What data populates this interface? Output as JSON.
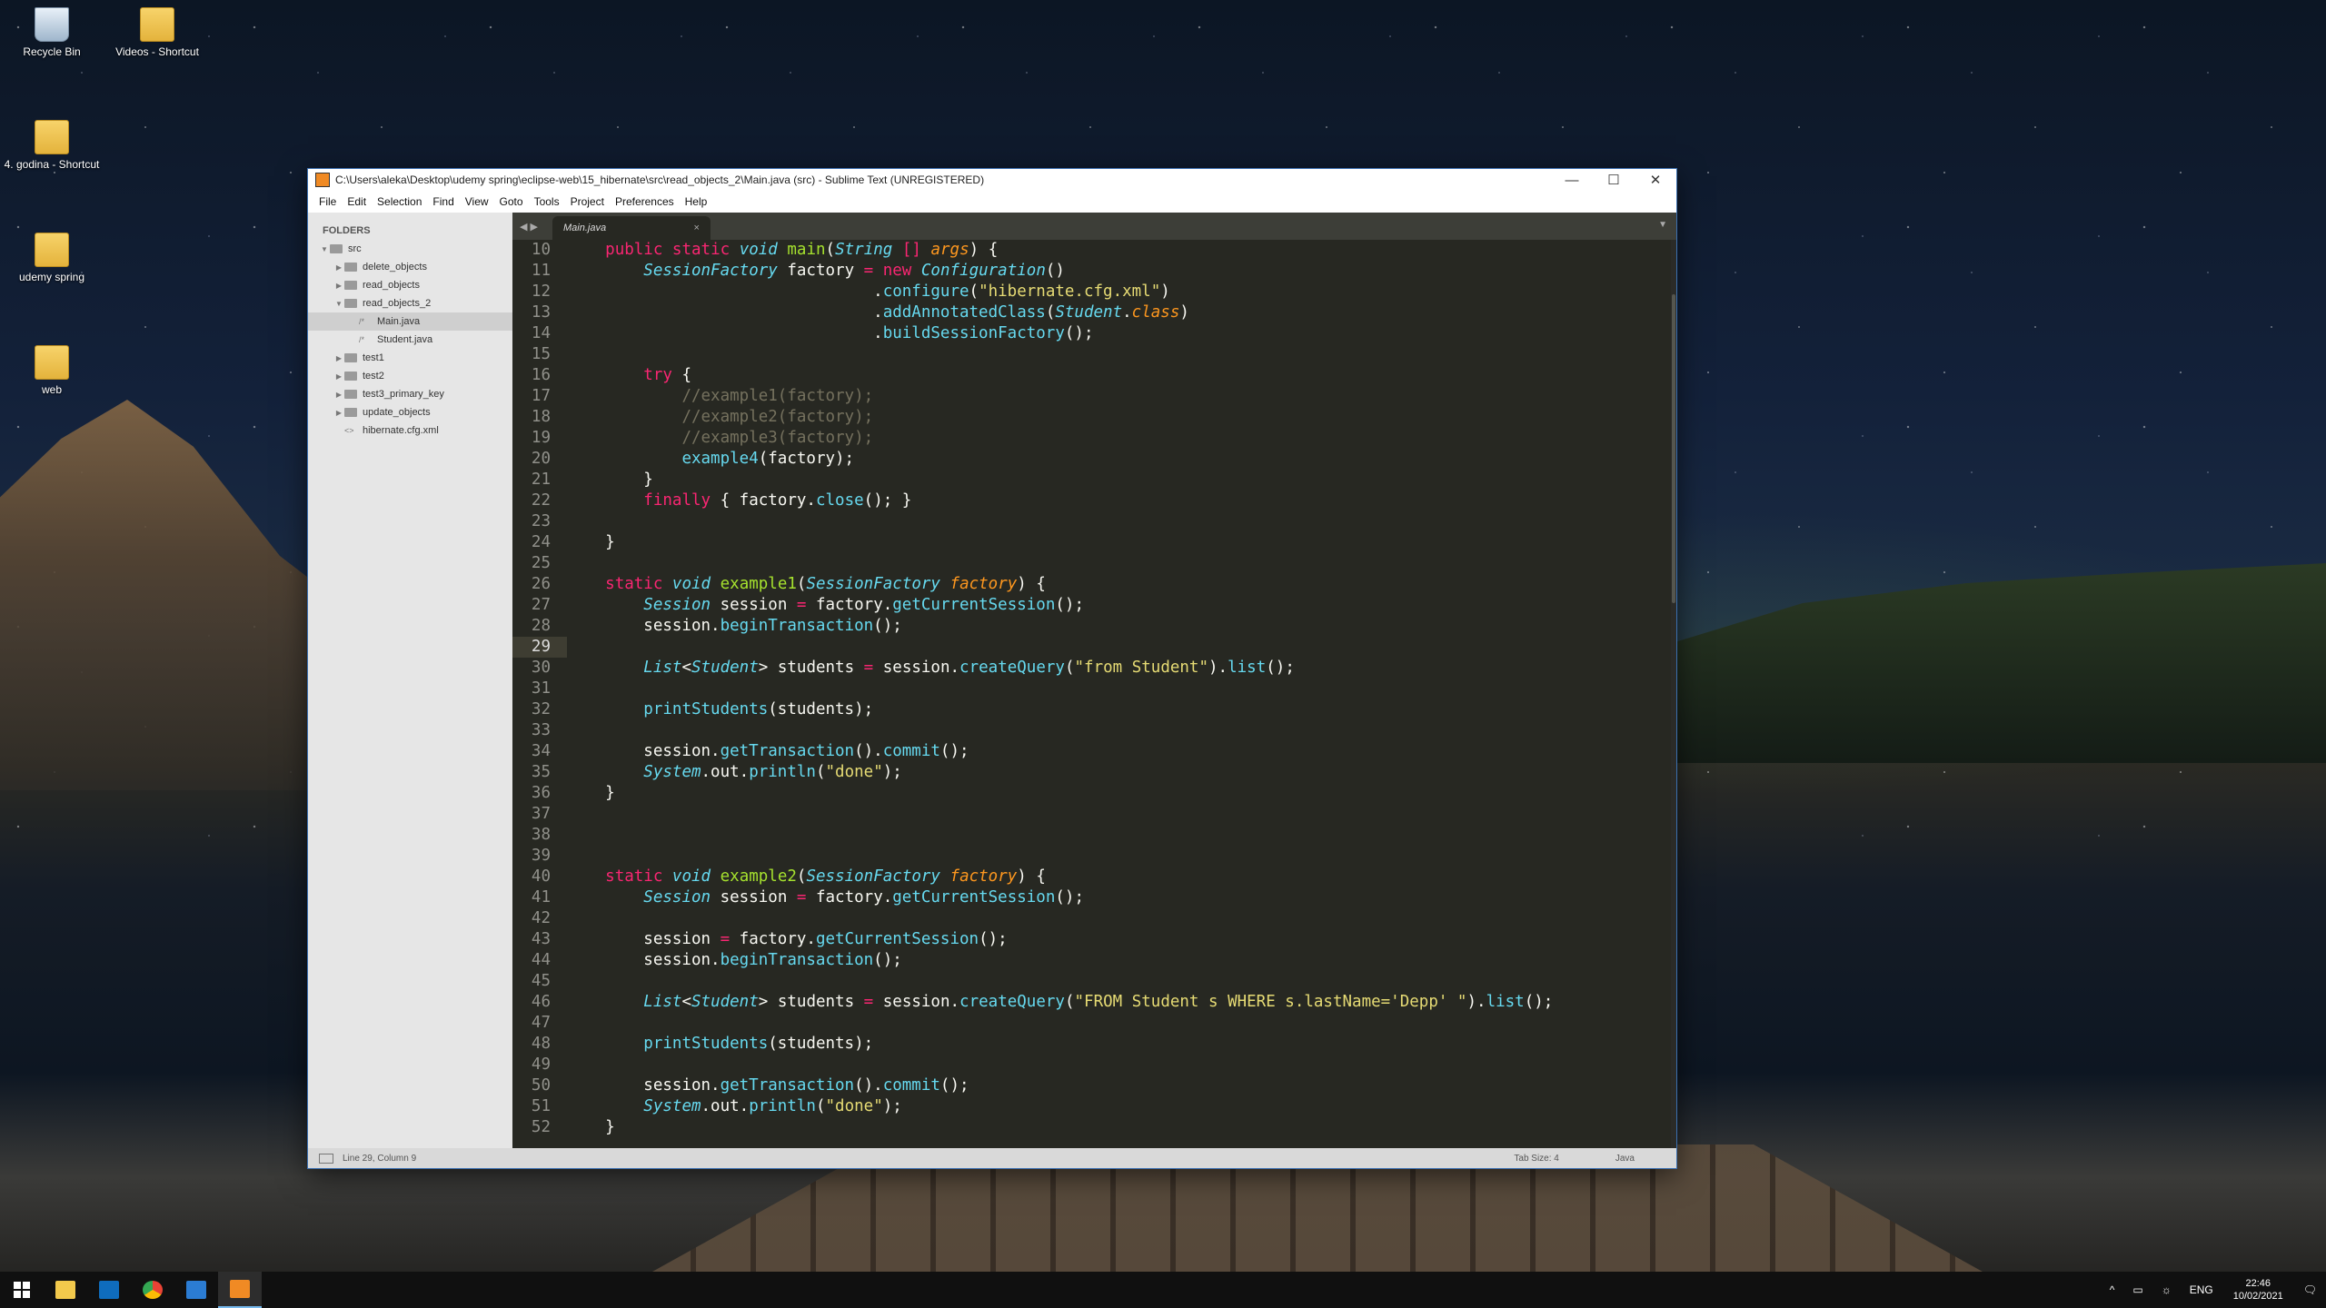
{
  "desktop": {
    "icons": [
      {
        "label": "Recycle Bin",
        "icon": "recycle-bin-icon"
      },
      {
        "label": "Videos - Shortcut",
        "icon": "folder-shortcut-icon"
      },
      {
        "label": "4. godina - Shortcut",
        "icon": "folder-shortcut-icon"
      },
      {
        "label": "udemy spring",
        "icon": "folder-icon"
      },
      {
        "label": "web",
        "icon": "folder-icon"
      }
    ]
  },
  "window": {
    "title": "C:\\Users\\aleka\\Desktop\\udemy spring\\eclipse-web\\15_hibernate\\src\\read_objects_2\\Main.java (src) - Sublime Text (UNREGISTERED)",
    "controls": {
      "minimize": "—",
      "maximize": "☐",
      "close": "✕"
    }
  },
  "menu": [
    "File",
    "Edit",
    "Selection",
    "Find",
    "View",
    "Goto",
    "Tools",
    "Project",
    "Preferences",
    "Help"
  ],
  "sidebar": {
    "header": "FOLDERS",
    "tree": [
      {
        "label": "src",
        "depth": 0,
        "type": "folder",
        "expanded": true
      },
      {
        "label": "delete_objects",
        "depth": 1,
        "type": "folder",
        "expanded": false
      },
      {
        "label": "read_objects",
        "depth": 1,
        "type": "folder",
        "expanded": false
      },
      {
        "label": "read_objects_2",
        "depth": 1,
        "type": "folder",
        "expanded": true
      },
      {
        "label": "Main.java",
        "depth": 2,
        "type": "file",
        "selected": true
      },
      {
        "label": "Student.java",
        "depth": 2,
        "type": "file"
      },
      {
        "label": "test1",
        "depth": 1,
        "type": "folder",
        "expanded": false
      },
      {
        "label": "test2",
        "depth": 1,
        "type": "folder",
        "expanded": false
      },
      {
        "label": "test3_primary_key",
        "depth": 1,
        "type": "folder",
        "expanded": false
      },
      {
        "label": "update_objects",
        "depth": 1,
        "type": "folder",
        "expanded": false
      },
      {
        "label": "hibernate.cfg.xml",
        "depth": 1,
        "type": "xml"
      }
    ]
  },
  "tabs": [
    {
      "label": "Main.java",
      "active": true,
      "close": "×"
    }
  ],
  "tab_nav": "◀ ▶",
  "tab_dropdown": "▼",
  "editor": {
    "current_line": 29,
    "lines": [
      {
        "n": 10,
        "t": [
          [
            "    ",
            ""
          ],
          [
            "public",
            "k"
          ],
          [
            " ",
            ""
          ],
          [
            "static",
            "k"
          ],
          [
            " ",
            ""
          ],
          [
            "void",
            "t"
          ],
          [
            " ",
            ""
          ],
          [
            "main",
            "f"
          ],
          [
            "(",
            ""
          ],
          [
            "String",
            "t"
          ],
          [
            " ",
            ""
          ],
          [
            "[]",
            "k"
          ],
          [
            " ",
            ""
          ],
          [
            "args",
            "p"
          ],
          [
            ") {",
            ""
          ]
        ]
      },
      {
        "n": 11,
        "t": [
          [
            "        ",
            ""
          ],
          [
            "SessionFactory",
            "t"
          ],
          [
            " factory ",
            ""
          ],
          [
            "=",
            "k"
          ],
          [
            " ",
            ""
          ],
          [
            "new",
            "k"
          ],
          [
            " ",
            ""
          ],
          [
            "Configuration",
            "t"
          ],
          [
            "()",
            ""
          ]
        ]
      },
      {
        "n": 12,
        "t": [
          [
            "                                .",
            ""
          ],
          [
            "configure",
            "c"
          ],
          [
            "(",
            ""
          ],
          [
            "\"hibernate.cfg.xml\"",
            "s"
          ],
          [
            ")",
            ""
          ]
        ]
      },
      {
        "n": 13,
        "t": [
          [
            "                                .",
            ""
          ],
          [
            "addAnnotatedClass",
            "c"
          ],
          [
            "(",
            ""
          ],
          [
            "Student",
            "t"
          ],
          [
            ".",
            ""
          ],
          [
            "class",
            "p"
          ],
          [
            ")",
            ""
          ]
        ]
      },
      {
        "n": 14,
        "t": [
          [
            "                                .",
            ""
          ],
          [
            "buildSessionFactory",
            "c"
          ],
          [
            "();",
            ""
          ]
        ]
      },
      {
        "n": 15,
        "t": [
          [
            "",
            ""
          ]
        ]
      },
      {
        "n": 16,
        "t": [
          [
            "        ",
            ""
          ],
          [
            "try",
            "k"
          ],
          [
            " {",
            ""
          ]
        ]
      },
      {
        "n": 17,
        "t": [
          [
            "            ",
            ""
          ],
          [
            "//example1(factory);",
            "m"
          ]
        ]
      },
      {
        "n": 18,
        "t": [
          [
            "            ",
            ""
          ],
          [
            "//example2(factory);",
            "m"
          ]
        ]
      },
      {
        "n": 19,
        "t": [
          [
            "            ",
            ""
          ],
          [
            "//example3(factory);",
            "m"
          ]
        ]
      },
      {
        "n": 20,
        "t": [
          [
            "            ",
            ""
          ],
          [
            "example4",
            "c"
          ],
          [
            "(factory);",
            ""
          ]
        ]
      },
      {
        "n": 21,
        "t": [
          [
            "        }",
            ""
          ]
        ]
      },
      {
        "n": 22,
        "t": [
          [
            "        ",
            ""
          ],
          [
            "finally",
            "k"
          ],
          [
            " { factory.",
            ""
          ],
          [
            "close",
            "c"
          ],
          [
            "(); }",
            ""
          ]
        ]
      },
      {
        "n": 23,
        "t": [
          [
            "",
            ""
          ]
        ]
      },
      {
        "n": 24,
        "t": [
          [
            "    }",
            ""
          ]
        ]
      },
      {
        "n": 25,
        "t": [
          [
            "",
            ""
          ]
        ]
      },
      {
        "n": 26,
        "t": [
          [
            "    ",
            ""
          ],
          [
            "static",
            "k"
          ],
          [
            " ",
            ""
          ],
          [
            "void",
            "t"
          ],
          [
            " ",
            ""
          ],
          [
            "example1",
            "f"
          ],
          [
            "(",
            ""
          ],
          [
            "SessionFactory",
            "t"
          ],
          [
            " ",
            ""
          ],
          [
            "factory",
            "p"
          ],
          [
            ") {",
            ""
          ]
        ]
      },
      {
        "n": 27,
        "t": [
          [
            "        ",
            ""
          ],
          [
            "Session",
            "t"
          ],
          [
            " session ",
            ""
          ],
          [
            "=",
            "k"
          ],
          [
            " factory.",
            ""
          ],
          [
            "getCurrentSession",
            "c"
          ],
          [
            "();",
            ""
          ]
        ]
      },
      {
        "n": 28,
        "t": [
          [
            "        session.",
            ""
          ],
          [
            "beginTransaction",
            "c"
          ],
          [
            "();",
            ""
          ]
        ]
      },
      {
        "n": 29,
        "t": [
          [
            "",
            ""
          ]
        ]
      },
      {
        "n": 30,
        "t": [
          [
            "        ",
            ""
          ],
          [
            "List",
            "t"
          ],
          [
            "<",
            ""
          ],
          [
            "Student",
            "t"
          ],
          [
            "> students ",
            ""
          ],
          [
            "=",
            "k"
          ],
          [
            " session.",
            ""
          ],
          [
            "createQuery",
            "c"
          ],
          [
            "(",
            ""
          ],
          [
            "\"from Student\"",
            "s"
          ],
          [
            ").",
            ""
          ],
          [
            "list",
            "c"
          ],
          [
            "();",
            ""
          ]
        ]
      },
      {
        "n": 31,
        "t": [
          [
            "",
            ""
          ]
        ]
      },
      {
        "n": 32,
        "t": [
          [
            "        ",
            ""
          ],
          [
            "printStudents",
            "c"
          ],
          [
            "(students);",
            ""
          ]
        ]
      },
      {
        "n": 33,
        "t": [
          [
            "",
            ""
          ]
        ]
      },
      {
        "n": 34,
        "t": [
          [
            "        session.",
            ""
          ],
          [
            "getTransaction",
            "c"
          ],
          [
            "().",
            ""
          ],
          [
            "commit",
            "c"
          ],
          [
            "();",
            ""
          ]
        ]
      },
      {
        "n": 35,
        "t": [
          [
            "        ",
            ""
          ],
          [
            "System",
            "t"
          ],
          [
            ".out.",
            ""
          ],
          [
            "println",
            "c"
          ],
          [
            "(",
            ""
          ],
          [
            "\"done\"",
            "s"
          ],
          [
            ");",
            ""
          ]
        ]
      },
      {
        "n": 36,
        "t": [
          [
            "    }",
            ""
          ]
        ]
      },
      {
        "n": 37,
        "t": [
          [
            "",
            ""
          ]
        ]
      },
      {
        "n": 38,
        "t": [
          [
            "",
            ""
          ]
        ]
      },
      {
        "n": 39,
        "t": [
          [
            "",
            ""
          ]
        ]
      },
      {
        "n": 40,
        "t": [
          [
            "    ",
            ""
          ],
          [
            "static",
            "k"
          ],
          [
            " ",
            ""
          ],
          [
            "void",
            "t"
          ],
          [
            " ",
            ""
          ],
          [
            "example2",
            "f"
          ],
          [
            "(",
            ""
          ],
          [
            "SessionFactory",
            "t"
          ],
          [
            " ",
            ""
          ],
          [
            "factory",
            "p"
          ],
          [
            ") {",
            ""
          ]
        ]
      },
      {
        "n": 41,
        "t": [
          [
            "        ",
            ""
          ],
          [
            "Session",
            "t"
          ],
          [
            " session ",
            ""
          ],
          [
            "=",
            "k"
          ],
          [
            " factory.",
            ""
          ],
          [
            "getCurrentSession",
            "c"
          ],
          [
            "();",
            ""
          ]
        ]
      },
      {
        "n": 42,
        "t": [
          [
            "",
            ""
          ]
        ]
      },
      {
        "n": 43,
        "t": [
          [
            "        session ",
            ""
          ],
          [
            "=",
            "k"
          ],
          [
            " factory.",
            ""
          ],
          [
            "getCurrentSession",
            "c"
          ],
          [
            "();",
            ""
          ]
        ]
      },
      {
        "n": 44,
        "t": [
          [
            "        session.",
            ""
          ],
          [
            "beginTransaction",
            "c"
          ],
          [
            "();",
            ""
          ]
        ]
      },
      {
        "n": 45,
        "t": [
          [
            "",
            ""
          ]
        ]
      },
      {
        "n": 46,
        "t": [
          [
            "        ",
            ""
          ],
          [
            "List",
            "t"
          ],
          [
            "<",
            ""
          ],
          [
            "Student",
            "t"
          ],
          [
            "> students ",
            ""
          ],
          [
            "=",
            "k"
          ],
          [
            " session.",
            ""
          ],
          [
            "createQuery",
            "c"
          ],
          [
            "(",
            ""
          ],
          [
            "\"FROM Student s WHERE s.lastName='Depp' \"",
            "s"
          ],
          [
            ").",
            ""
          ],
          [
            "list",
            "c"
          ],
          [
            "();",
            ""
          ]
        ]
      },
      {
        "n": 47,
        "t": [
          [
            "",
            ""
          ]
        ]
      },
      {
        "n": 48,
        "t": [
          [
            "        ",
            ""
          ],
          [
            "printStudents",
            "c"
          ],
          [
            "(students);",
            ""
          ]
        ]
      },
      {
        "n": 49,
        "t": [
          [
            "",
            ""
          ]
        ]
      },
      {
        "n": 50,
        "t": [
          [
            "        session.",
            ""
          ],
          [
            "getTransaction",
            "c"
          ],
          [
            "().",
            ""
          ],
          [
            "commit",
            "c"
          ],
          [
            "();",
            ""
          ]
        ]
      },
      {
        "n": 51,
        "t": [
          [
            "        ",
            ""
          ],
          [
            "System",
            "t"
          ],
          [
            ".out.",
            ""
          ],
          [
            "println",
            "c"
          ],
          [
            "(",
            ""
          ],
          [
            "\"done\"",
            "s"
          ],
          [
            ");",
            ""
          ]
        ]
      },
      {
        "n": 52,
        "t": [
          [
            "    }",
            ""
          ]
        ]
      }
    ]
  },
  "statusbar": {
    "position": "Line 29, Column 9",
    "tab_size": "Tab Size: 4",
    "syntax": "Java"
  },
  "taskbar": {
    "apps": [
      "start-icon",
      "file-explorer-icon",
      "outlook-icon",
      "chrome-icon",
      "word-icon",
      "sublime-text-icon"
    ],
    "active_app": "sublime-text-icon",
    "tray_caret": "^",
    "language": "ENG",
    "time": "22:46",
    "date": "10/02/2021"
  },
  "colors": {
    "keyword": "#f92672",
    "type": "#66d9ef",
    "function": "#a6e22e",
    "string": "#e6db74",
    "param": "#fd971f",
    "comment": "#75715e",
    "editor_bg": "#272822",
    "sidebar_bg": "#e6e6e6"
  }
}
